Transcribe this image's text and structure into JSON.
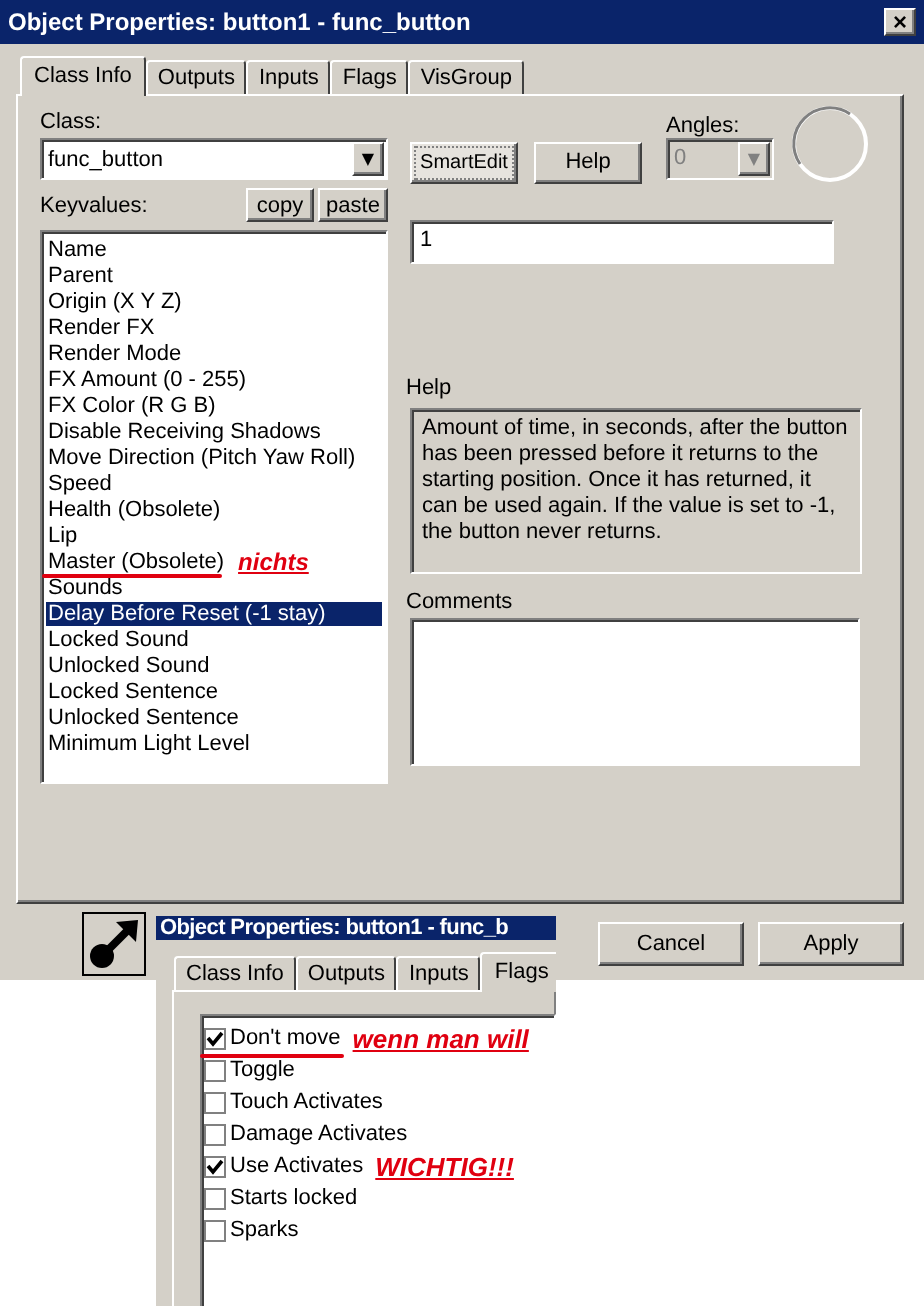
{
  "window": {
    "title": "Object Properties: button1 - func_button",
    "close": "×"
  },
  "tabs": [
    {
      "label": "Class Info",
      "selected": true
    },
    {
      "label": "Outputs",
      "selected": false
    },
    {
      "label": "Inputs",
      "selected": false
    },
    {
      "label": "Flags",
      "selected": false
    },
    {
      "label": "VisGroup",
      "selected": false
    }
  ],
  "class_field": {
    "label": "Class:",
    "value": "func_button",
    "arrow": "▼"
  },
  "smartedit_button": {
    "label": "SmartEdit",
    "pressed": true
  },
  "help_button": {
    "label": "Help"
  },
  "angles": {
    "label": "Angles:",
    "value": "0",
    "arrow": "▼",
    "disabled": true
  },
  "keyvalues": {
    "label": "Keyvalues:",
    "copy": "copy",
    "paste": "paste",
    "items": [
      {
        "label": "Name",
        "selected": false
      },
      {
        "label": "Parent",
        "selected": false
      },
      {
        "label": "Origin (X Y Z)",
        "selected": false
      },
      {
        "label": "Render FX",
        "selected": false
      },
      {
        "label": "Render Mode",
        "selected": false
      },
      {
        "label": "FX Amount (0 - 255)",
        "selected": false
      },
      {
        "label": "FX Color (R G B)",
        "selected": false
      },
      {
        "label": "Disable Receiving Shadows",
        "selected": false
      },
      {
        "label": "Move Direction (Pitch Yaw Roll)",
        "selected": false
      },
      {
        "label": "Speed",
        "selected": false
      },
      {
        "label": "Health (Obsolete)",
        "selected": false
      },
      {
        "label": "Lip",
        "selected": false
      },
      {
        "label": "Master (Obsolete)",
        "selected": false,
        "note": "nichts"
      },
      {
        "label": "Sounds",
        "selected": false
      },
      {
        "label": "Delay Before Reset (-1 stay)",
        "selected": true
      },
      {
        "label": "Locked Sound",
        "selected": false
      },
      {
        "label": "Unlocked Sound",
        "selected": false
      },
      {
        "label": "Locked Sentence",
        "selected": false
      },
      {
        "label": "Unlocked Sentence",
        "selected": false
      },
      {
        "label": "Minimum Light Level",
        "selected": false
      }
    ]
  },
  "value_field": {
    "value": "1"
  },
  "help": {
    "label": "Help",
    "text": "Amount of time, in seconds, after the button has been pressed before it returns to the starting position. Once it has returned, it can be used again. If the value is set to -1, the button never returns."
  },
  "comments": {
    "label": "Comments"
  },
  "footer_buttons": [
    "Cancel",
    "Apply"
  ],
  "inset": {
    "title": "Object Properties: button1 - func_b",
    "tabs": [
      {
        "label": "Class Info",
        "selected": false
      },
      {
        "label": "Outputs",
        "selected": false
      },
      {
        "label": "Inputs",
        "selected": false
      },
      {
        "label": "Flags",
        "selected": true
      }
    ],
    "flags": [
      {
        "label": "Don't move",
        "checked": true,
        "note": "wenn man will"
      },
      {
        "label": "Toggle",
        "checked": false
      },
      {
        "label": "Touch Activates",
        "checked": false
      },
      {
        "label": "Damage Activates",
        "checked": false
      },
      {
        "label": "Use Activates",
        "checked": true,
        "note": "WICHTIG!!!"
      },
      {
        "label": "Starts locked",
        "checked": false
      },
      {
        "label": "Sparks",
        "checked": false
      }
    ]
  }
}
